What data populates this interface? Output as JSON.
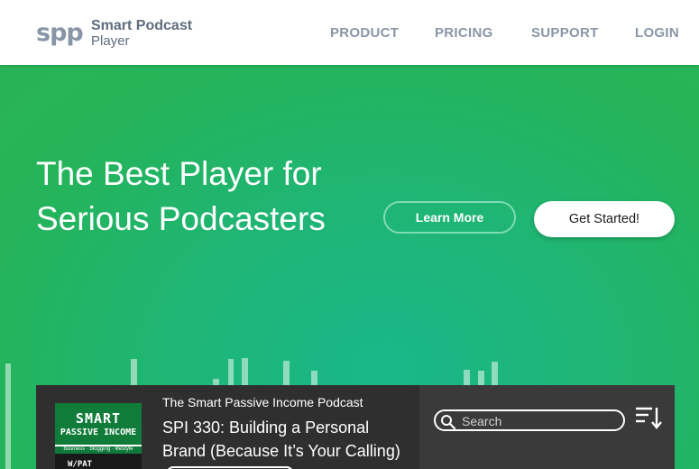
{
  "brand": {
    "mark": "spp",
    "name_line1": "Smart Podcast",
    "name_line2": "Player"
  },
  "nav": {
    "items": [
      {
        "label": "PRODUCT"
      },
      {
        "label": "PRICING"
      },
      {
        "label": "SUPPORT"
      },
      {
        "label": "LOGIN"
      }
    ]
  },
  "hero": {
    "headline_line1": "The Best Player for",
    "headline_line2": "Serious Podcasters",
    "learn_more_label": "Learn More",
    "get_started_label": "Get Started!"
  },
  "player": {
    "cover": {
      "title_line1": "SMART",
      "title_line2": "PASSIVE INCOME",
      "tagline": "business · blogging · lifestyle",
      "host": "W/PAT"
    },
    "show_name": "The Smart Passive Income Podcast",
    "episode_line1": "SPI 330: Building a Personal",
    "episode_line2": "Brand (Because It’s Your Calling)",
    "search_placeholder": "Search",
    "icons": {
      "search": "search-icon",
      "sort": "sort-descending-icon"
    }
  },
  "colors": {
    "hero_green": "#22b565",
    "player_dark": "#2f2f2f",
    "nav_text": "#8a96a6"
  }
}
